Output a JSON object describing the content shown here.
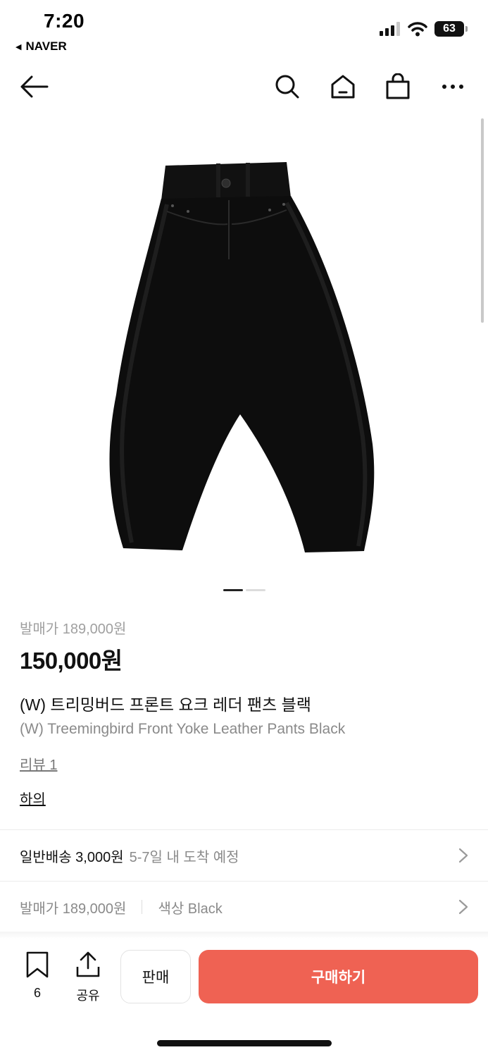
{
  "status_bar": {
    "time": "7:20",
    "back_app": "NAVER",
    "battery": "63"
  },
  "nav": {
    "icons": [
      "back-arrow-icon",
      "search-icon",
      "home-icon",
      "shopping-bag-icon",
      "more-icon"
    ]
  },
  "product": {
    "image_icon": "black-leather-pants-image",
    "carousel": {
      "total": 2,
      "active": 1
    },
    "retail_price": "발매가 189,000원",
    "price": "150,000원",
    "name_ko": "(W) 트리밍버드 프론트 요크 레더 팬츠 블랙",
    "name_en": "(W) Treemingbird Front Yoke Leather Pants Black",
    "review_link": "리뷰 1",
    "category_link": "하의"
  },
  "delivery": {
    "label": "일반배송 3,000원",
    "estimate": "5-7일 내 도착 예정"
  },
  "options": {
    "retail_price": "발매가 189,000원",
    "color": "색상 Black"
  },
  "bottom_bar": {
    "bookmark_count": "6",
    "share_label": "공유",
    "sell_label": "판매",
    "buy_label": "구매하기"
  },
  "colors": {
    "accent": "#ef6253",
    "muted_text": "#8a8a8a",
    "divider": "#ececec"
  }
}
